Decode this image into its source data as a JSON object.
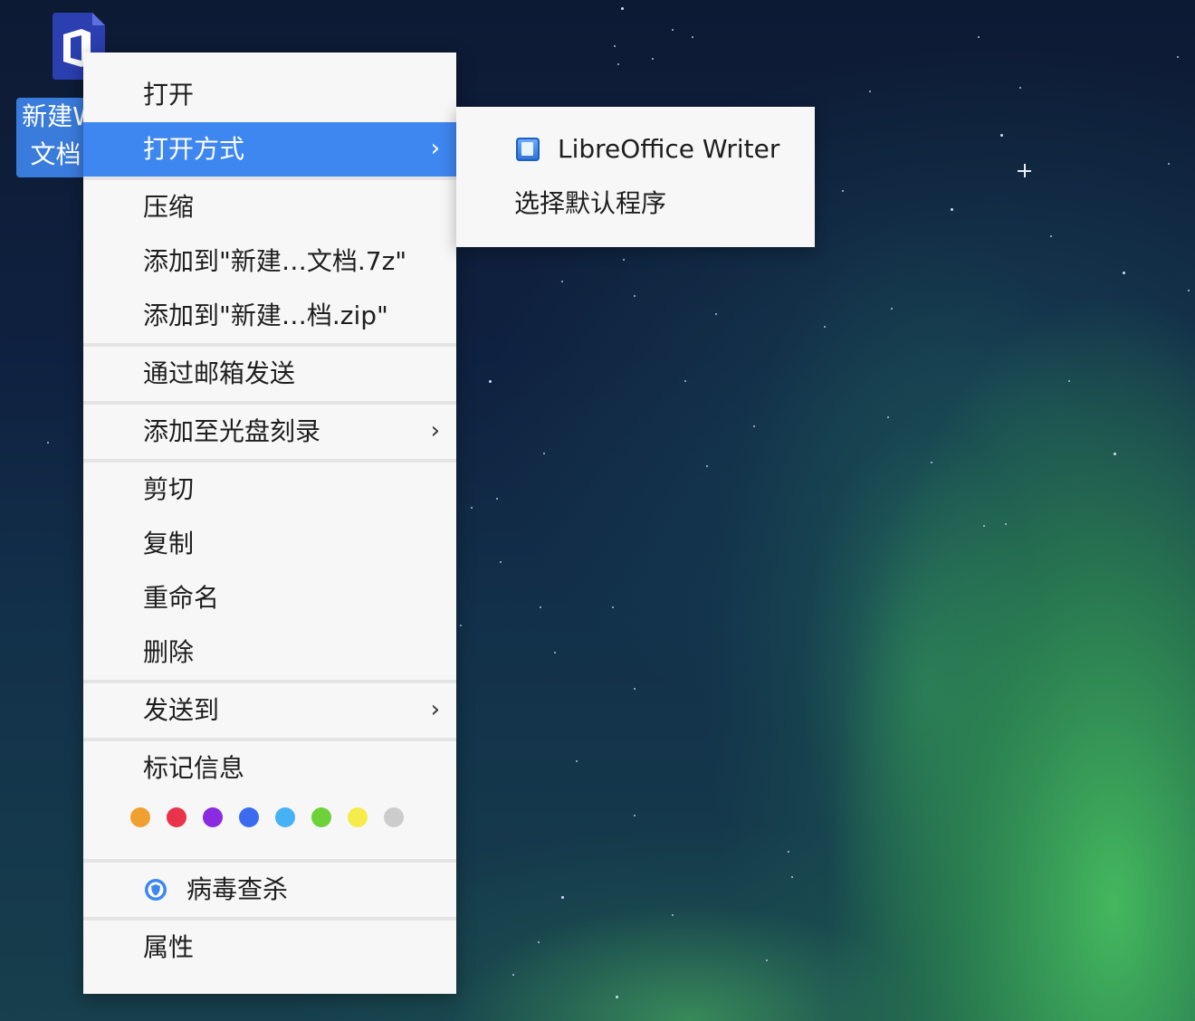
{
  "desktop": {
    "icon": {
      "label_line1": "新建W",
      "label_line2": "文档.",
      "glyph": "office-document-icon"
    }
  },
  "context_menu": {
    "groups": [
      [
        {
          "label": "打开",
          "has_submenu": false
        },
        {
          "label": "打开方式",
          "has_submenu": true,
          "active": true
        },
        {
          "label": "",
          "separator": true
        }
      ]
    ],
    "items": {
      "open": "打开",
      "open_with": "打开方式",
      "compress": "压缩",
      "add_7z": "添加到\"新建…文档.7z\"",
      "add_zip": "添加到\"新建…档.zip\"",
      "send_mail": "通过邮箱发送",
      "burn_disc": "添加至光盘刻录",
      "cut": "剪切",
      "copy": "复制",
      "rename": "重命名",
      "delete": "删除",
      "send_to": "发送到",
      "tag_info": "标记信息",
      "virus_scan": "病毒查杀",
      "properties": "属性"
    },
    "submenu_chevron": "›",
    "tag_colors": [
      "#f0a030",
      "#e8334a",
      "#8a2be2",
      "#3b6cf0",
      "#45b2f5",
      "#6fd13a",
      "#f5ec4b",
      "#cccccc"
    ]
  },
  "open_with_submenu": {
    "items": {
      "libreoffice_writer": "LibreOffice Writer",
      "choose_default": "选择默认程序"
    }
  }
}
